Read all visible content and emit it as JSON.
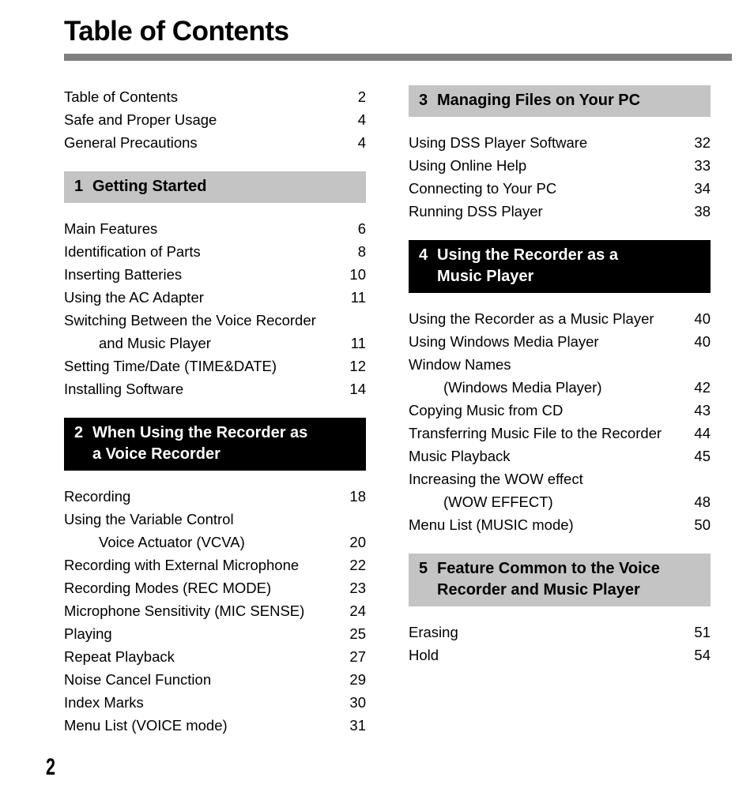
{
  "page": {
    "title": "Table of Contents",
    "number": "2",
    "rule_color": "#808080",
    "banner_gray": "#c4c4c4",
    "banner_black": "#000000"
  },
  "left_column": {
    "intro_entries": [
      {
        "label": "Table of Contents",
        "page": "2"
      },
      {
        "label": "Safe and Proper Usage",
        "page": "4"
      },
      {
        "label": "General Precautions",
        "page": "4"
      }
    ],
    "section1": {
      "number": "1",
      "title_line1": "Getting Started",
      "title_line2": "",
      "style": "gray",
      "entries": [
        {
          "label": "Main Features",
          "page": "6"
        },
        {
          "label": "Identification of Parts",
          "page": "8"
        },
        {
          "label": "Inserting Batteries",
          "page": "10"
        },
        {
          "label": "Using the AC Adapter",
          "page": "11"
        },
        {
          "label": "Switching Between the Voice Recorder",
          "label2": "and Music Player",
          "page": "11"
        },
        {
          "label": "Setting Time/Date (TIME&DATE)",
          "page": "12"
        },
        {
          "label": "Installing Software",
          "page": "14"
        }
      ]
    },
    "section2": {
      "number": "2",
      "title_line1": "When Using the Recorder  as",
      "title_line2": "a Voice Recorder",
      "style": "black",
      "entries": [
        {
          "label": "Recording",
          "page": "18"
        },
        {
          "label": "Using the Variable Control",
          "label2": "Voice Actuator (VCVA)",
          "page": "20"
        },
        {
          "label": "Recording with External Microphone",
          "page": "22"
        },
        {
          "label": "Recording Modes (REC MODE)",
          "page": "23"
        },
        {
          "label": "Microphone Sensitivity (MIC SENSE)",
          "page": "24"
        },
        {
          "label": "Playing",
          "page": "25"
        },
        {
          "label": "Repeat Playback",
          "page": "27"
        },
        {
          "label": "Noise Cancel Function",
          "page": "29"
        },
        {
          "label": "Index Marks",
          "page": "30"
        },
        {
          "label": "Menu List (VOICE mode)",
          "page": "31"
        }
      ]
    }
  },
  "right_column": {
    "section3": {
      "number": "3",
      "title_line1": "Managing Files on Your PC",
      "title_line2": "",
      "style": "gray",
      "entries": [
        {
          "label": "Using DSS Player Software",
          "page": "32"
        },
        {
          "label": "Using Online Help",
          "page": "33"
        },
        {
          "label": "Connecting to Your PC",
          "page": "34"
        },
        {
          "label": "Running DSS Player",
          "page": "38"
        }
      ]
    },
    "section4": {
      "number": "4",
      "title_line1": "Using the Recorder as a",
      "title_line2": "Music Player",
      "style": "black",
      "entries": [
        {
          "label": "Using the Recorder as a Music Player",
          "page": "40"
        },
        {
          "label": "Using Windows Media Player",
          "page": "40"
        },
        {
          "label": "Window Names",
          "label2": "(Windows Media Player)",
          "page": "42"
        },
        {
          "label": "Copying Music from CD",
          "page": "43"
        },
        {
          "label": "Transferring Music File to the Recorder",
          "page": "44"
        },
        {
          "label": "Music Playback",
          "page": "45"
        },
        {
          "label": "Increasing the WOW effect",
          "label2": "(WOW EFFECT)",
          "page": "48"
        },
        {
          "label": "Menu List (MUSIC mode)",
          "page": "50"
        }
      ]
    },
    "section5": {
      "number": "5",
      "title_line1": "Feature Common to the Voice",
      "title_line2": "Recorder and Music Player",
      "style": "gray",
      "entries": [
        {
          "label": "Erasing",
          "page": "51"
        },
        {
          "label": "Hold",
          "page": "54"
        }
      ]
    }
  }
}
